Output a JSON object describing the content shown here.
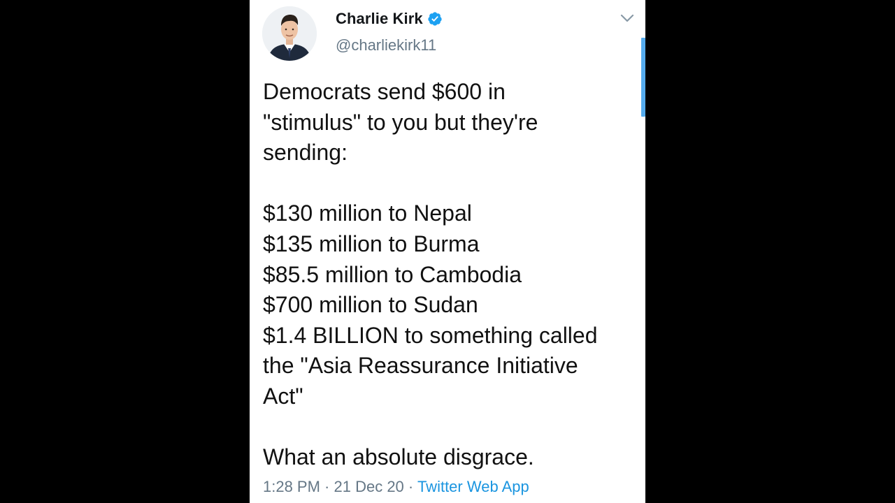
{
  "tweet": {
    "author": {
      "display_name": "Charlie Kirk",
      "handle": "@charliekirk11",
      "verified": true,
      "avatar_icon": "profile-photo"
    },
    "text_lines": [
      "Democrats send $600 in",
      "\"stimulus\" to you but they're",
      "sending:",
      "",
      "$130 million to Nepal",
      "$135 million to Burma",
      "$85.5 million to Cambodia",
      "$700 million to Sudan",
      "$1.4 BILLION to something called",
      "the \"Asia Reassurance Initiative",
      "Act\"",
      "",
      "What an absolute disgrace."
    ],
    "meta": {
      "time": "1:28 PM",
      "separator": " · ",
      "date": "21 Dec 20",
      "source": "Twitter Web App"
    }
  },
  "colors": {
    "background": "#000000",
    "card": "#ffffff",
    "accent": "#1da1f2",
    "link": "#1b95e0",
    "muted": "#657786",
    "text": "#111111"
  },
  "icons": {
    "verified": "verified-badge-icon",
    "menu": "chevron-down-icon"
  }
}
